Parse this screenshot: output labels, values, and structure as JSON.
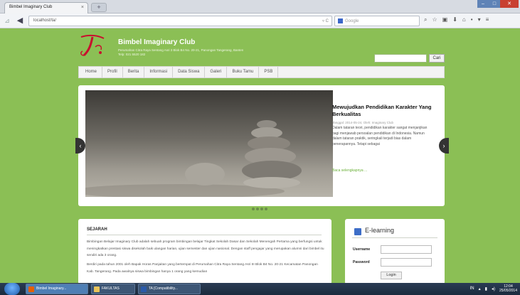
{
  "browser": {
    "tab_title": "Bimbel Imaginary Club",
    "tab_close": "×",
    "new_tab": "+",
    "url": "localhost/ta/",
    "search_placeholder": "Google",
    "window": {
      "min": "–",
      "max": "□",
      "close": "✕"
    }
  },
  "site": {
    "title": "Bimbel Imaginary Club",
    "address": "Perumahan Citra Raya Sentang Asri 3 Blok B4 No. 20-21, Panongan Tangerang, Banten",
    "phone": "Telp: 021 5520 182",
    "search_button": "Cari"
  },
  "menu": [
    "Home",
    "Profil",
    "Berita",
    "Informasi",
    "Data Siswa",
    "Galeri",
    "Buku Tamu",
    "PSB"
  ],
  "slider": {
    "title": "Mewujudkan Pendidikan Karakter Yang Berkualitas",
    "meta": "Tanggal: 2014-05-24, Oleh: Imaginary Club",
    "text": "Dalam tataran teori, pendidikan karakter sangat menjanjikan bagi menjawab persoalan pendidikan di Indonesia. Namun dalam tataran praktik, seringkali terjadi bias dalam penerapannya. Tetapi sebagai",
    "more": "Baca selengkapnya ..."
  },
  "sejarah": {
    "title": "SEJARAH",
    "p1": "Bimbingan Belajar Imaginary Club adalah sebuah program bimbingan belajar Tingkat Sekolah Dasar dan Sekolah Menengah Pertama yang berfungsi untuk meningkatkan prestasi siswa disekolah baik ulangan harian, ujian semester dan ujian nasional. Dengan staff pengajar yang merupakan alumni dari bimbel itu sendiri ada 3 orang.",
    "p2": "Berdiri pada tahun 2001 oleh Bapak Horas Panjaitan yang bertempat di Perumahan Citra Raya Sentang Asri III Blok B4 No. 20-21 Kecamatan Panongan Kab. Tangerang. Pada awalnya siswa bimbingan hanya 1 orang yang kemudian"
  },
  "elearning": {
    "title": "E-learning",
    "username_label": "Username",
    "password_label": "Password",
    "login_button": "Login"
  },
  "taskbar": {
    "items": [
      "Bimbel Imaginary...",
      "FAKULTAS",
      "TA [Compatibility..."
    ],
    "lang": "IN",
    "time": "12:04",
    "date": "25/05/2014"
  }
}
